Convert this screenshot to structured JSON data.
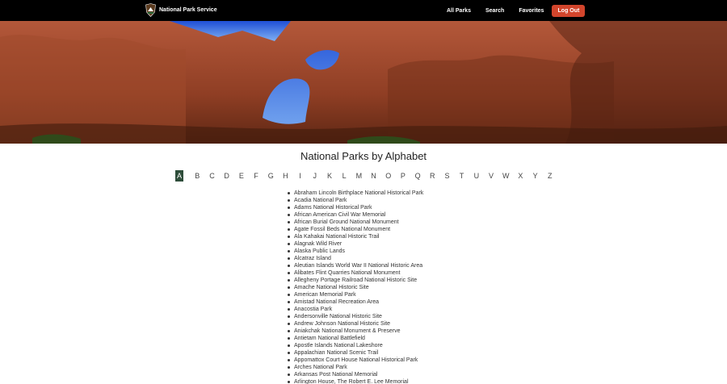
{
  "nav": {
    "brand_name": "National Park Service",
    "links": [
      "All Parks",
      "Search",
      "Favorites"
    ],
    "logout_label": "Log Out"
  },
  "hero": {
    "image": "double-arch-red-rock"
  },
  "title": "National Parks by Alphabet",
  "alphabet": {
    "selected": "A",
    "letters": [
      "A",
      "B",
      "C",
      "D",
      "E",
      "F",
      "G",
      "H",
      "I",
      "J",
      "K",
      "L",
      "M",
      "N",
      "O",
      "P",
      "Q",
      "R",
      "S",
      "T",
      "U",
      "V",
      "W",
      "X",
      "Y",
      "Z"
    ]
  },
  "parks": [
    "Abraham Lincoln Birthplace National Historical Park",
    "Acadia National Park",
    "Adams National Historical Park",
    "African American Civil War Memorial",
    "African Burial Ground National Monument",
    "Agate Fossil Beds National Monument",
    "Ala Kahakai National Historic Trail",
    "Alagnak Wild River",
    "Alaska Public Lands",
    "Alcatraz Island",
    "Aleutian Islands World War II National Historic Area",
    "Alibates Flint Quarries National Monument",
    "Allegheny Portage Railroad National Historic Site",
    "Amache National Historic Site",
    "American Memorial Park",
    "Amistad National Recreation Area",
    "Anacostia Park",
    "Andersonville National Historic Site",
    "Andrew Johnson National Historic Site",
    "Aniakchak National Monument & Preserve",
    "Antietam National Battlefield",
    "Apostle Islands National Lakeshore",
    "Appalachian National Scenic Trail",
    "Appomattox Court House National Historical Park",
    "Arches National Park",
    "Arkansas Post National Memorial",
    "Arlington House, The Robert E. Lee Memorial"
  ],
  "colors": {
    "nav_bg": "#000000",
    "logout_bg": "#d2452c",
    "active_letter_bg": "#2e4d3a"
  }
}
